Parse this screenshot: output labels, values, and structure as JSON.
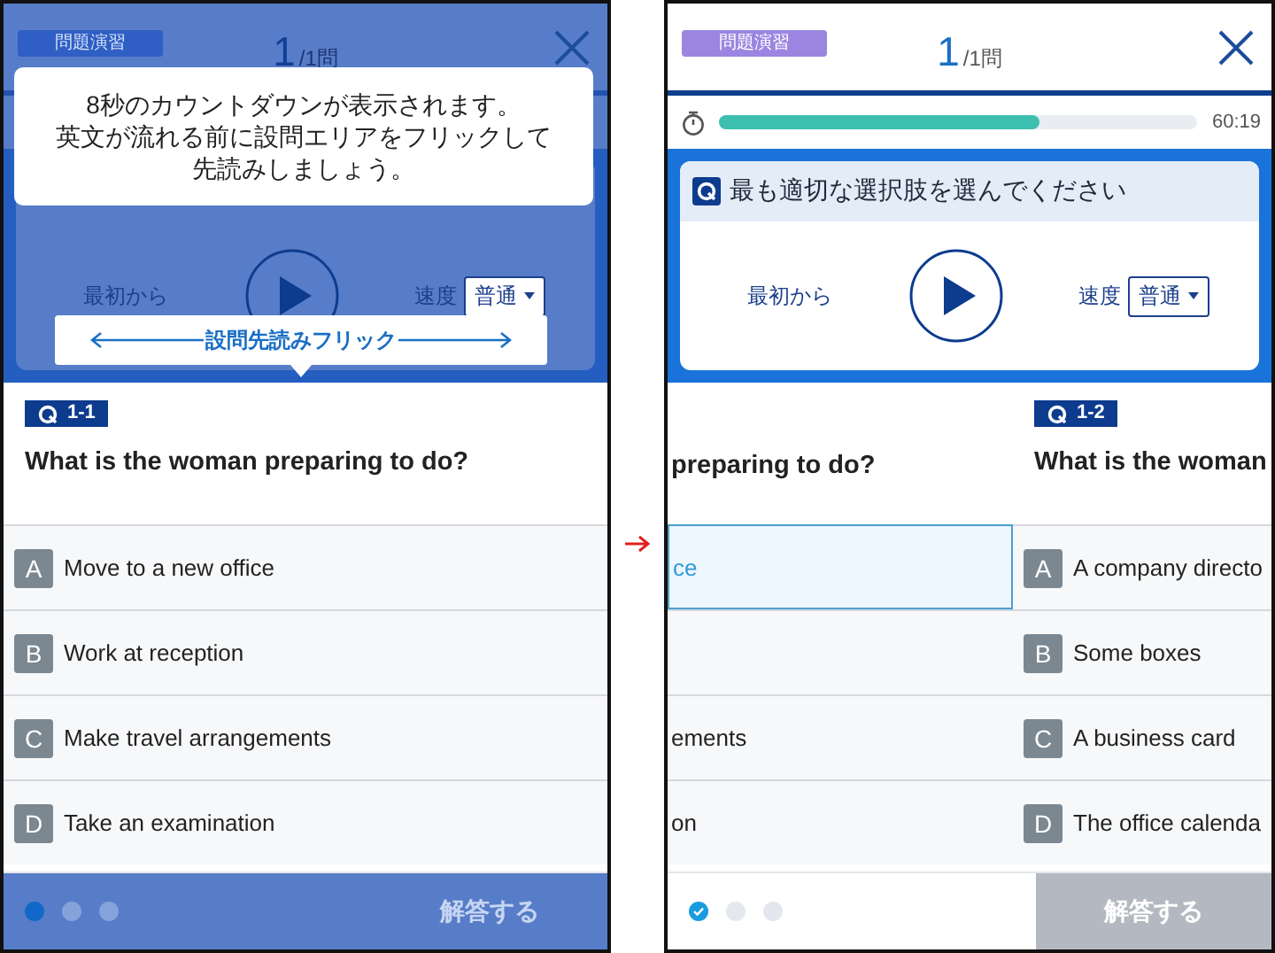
{
  "phones": [
    {
      "dimmed": true,
      "header": {
        "badge": "問題演習",
        "current": "1",
        "total": "/1問"
      },
      "player": {
        "restart": "最初から",
        "speed_label": "速度",
        "speed": "普通"
      },
      "tooltip": [
        "8秒のカウントダウンが表示されます。",
        "英文が流れる前に設問エリアをフリックして",
        "先読みしましょう。"
      ],
      "flick_hint": "設問先読みフリック",
      "panes": [
        {
          "kind": "full",
          "number": "1-1",
          "question": "What is the woman preparing to do?",
          "options": [
            {
              "letter": "A",
              "text": "Move to a new office",
              "selected": false
            },
            {
              "letter": "B",
              "text": "Work at reception",
              "selected": false
            },
            {
              "letter": "C",
              "text": "Make travel arrangements",
              "selected": false
            },
            {
              "letter": "D",
              "text": "Take an examination",
              "selected": false
            }
          ]
        }
      ],
      "dots": [
        {
          "current": true,
          "answered": false
        },
        {
          "current": false,
          "answered": false
        },
        {
          "current": false,
          "answered": false
        }
      ],
      "answer_button": {
        "label": "解答する",
        "disabled": true
      }
    },
    {
      "dimmed": false,
      "header": {
        "badge": "問題演習",
        "current": "1",
        "total": "/1問"
      },
      "timer": {
        "level": 0.67,
        "reading": "60:19"
      },
      "card_title": "最も適切な選択肢を選んでください",
      "player": {
        "restart": "最初から",
        "speed_label": "速度",
        "speed": "普通"
      },
      "panes": [
        {
          "kind": "tail",
          "question": "preparing to do?",
          "options": [
            {
              "text": "ce",
              "selected": true
            },
            {
              "selected": false
            },
            {
              "text": "ements",
              "selected": false
            },
            {
              "text": "on",
              "selected": false
            }
          ]
        },
        {
          "kind": "head",
          "number": "1-2",
          "question": "What is the woman",
          "options": [
            {
              "letter": "A",
              "text": "A company directo",
              "selected": false
            },
            {
              "letter": "B",
              "text": "Some boxes",
              "selected": false
            },
            {
              "letter": "C",
              "text": "A business card",
              "selected": false
            },
            {
              "letter": "D",
              "text": "The office calenda",
              "selected": false
            }
          ]
        }
      ],
      "dots": [
        {
          "current": false,
          "answered": true
        },
        {
          "current": false,
          "answered": false
        },
        {
          "current": false,
          "answered": false
        }
      ],
      "answer_button": {
        "label": "解答する",
        "disabled": true
      }
    }
  ]
}
